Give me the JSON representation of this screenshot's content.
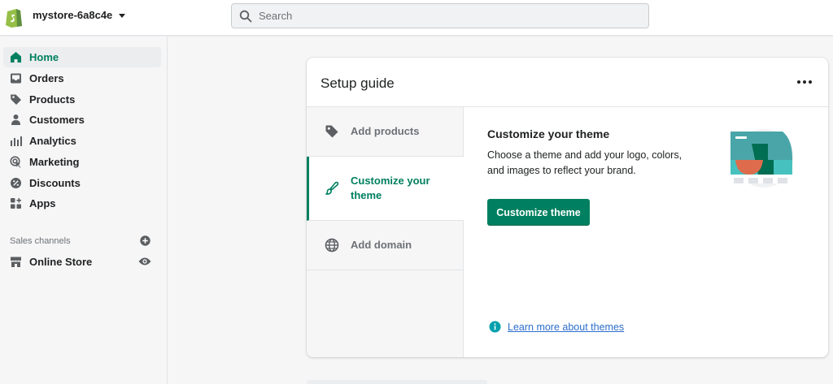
{
  "topbar": {
    "store_name": "mystore-6a8c4e",
    "search_placeholder": "Search",
    "search_value": ""
  },
  "sidebar": {
    "items": [
      {
        "label": "Home",
        "icon": "home-icon",
        "active": true
      },
      {
        "label": "Orders",
        "icon": "inbox-icon"
      },
      {
        "label": "Products",
        "icon": "tag-icon"
      },
      {
        "label": "Customers",
        "icon": "person-icon"
      },
      {
        "label": "Analytics",
        "icon": "bar-chart-icon"
      },
      {
        "label": "Marketing",
        "icon": "target-icon"
      },
      {
        "label": "Discounts",
        "icon": "discount-icon"
      },
      {
        "label": "Apps",
        "icon": "apps-icon"
      }
    ],
    "sales_channels_title": "Sales channels",
    "online_store_label": "Online Store"
  },
  "setup_guide": {
    "title": "Setup guide",
    "steps": [
      {
        "label": "Add products",
        "icon": "tag-icon"
      },
      {
        "label": "Customize your theme",
        "icon": "paintbrush-icon",
        "active": true
      },
      {
        "label": "Add domain",
        "icon": "globe-icon"
      }
    ],
    "content_title": "Customize your theme",
    "content_description": "Choose a theme and add your logo, colors, and images to reflect your brand.",
    "primary_button_label": "Customize theme",
    "learn_more_label": "Learn more about themes"
  },
  "colors": {
    "accent": "#008060",
    "link": "#2c6ecb",
    "info": "#00a0ac"
  }
}
